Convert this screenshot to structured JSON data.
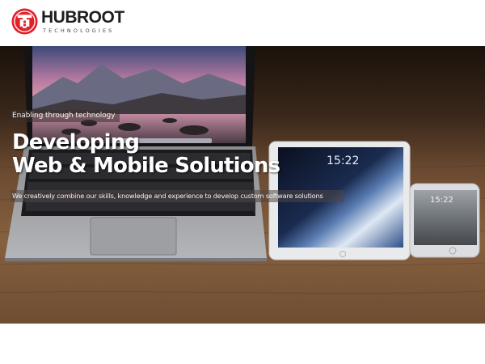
{
  "brand": {
    "name": "HUBROOT",
    "sub": "TECHNOLOGIES",
    "primary_color": "#e22027",
    "dark_color": "#1e1e1e"
  },
  "hero": {
    "tagline": "Enabling through technology",
    "headline_line1": "Developing",
    "headline_line2": "Web & Mobile Solutions",
    "description": "We creatively combine our skills, knowledge and experience to develop custom software solutions",
    "tablet_time": "15:22",
    "phone_time": "15:22"
  }
}
